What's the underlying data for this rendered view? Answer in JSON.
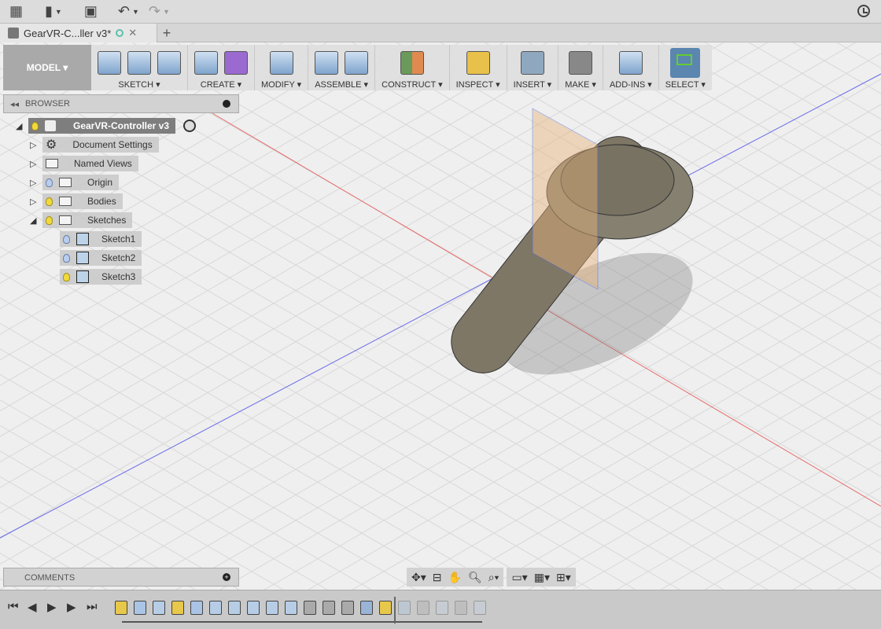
{
  "topbar": {
    "icons": [
      "apps-grid-icon",
      "file-icon",
      "save-icon",
      "undo-icon",
      "redo-icon",
      "clock-icon"
    ]
  },
  "tab": {
    "title": "GearVR-C...ller v3*",
    "close": "✕",
    "new_tab": "+"
  },
  "toolbar": {
    "workspace": "MODEL ▾",
    "groups": [
      {
        "label": "SKETCH ▾",
        "icons": [
          "create-sketch-icon",
          "spline-icon",
          "rectangle-icon"
        ]
      },
      {
        "label": "CREATE ▾",
        "icons": [
          "extrude-icon",
          "form-icon"
        ]
      },
      {
        "label": "MODIFY ▾",
        "icons": [
          "press-pull-icon"
        ]
      },
      {
        "label": "ASSEMBLE ▾",
        "icons": [
          "new-component-icon",
          "joint-icon"
        ]
      },
      {
        "label": "CONSTRUCT ▾",
        "icons": [
          "offset-plane-icon"
        ]
      },
      {
        "label": "INSPECT ▾",
        "icons": [
          "measure-icon"
        ]
      },
      {
        "label": "INSERT ▾",
        "icons": [
          "insert-image-icon"
        ]
      },
      {
        "label": "MAKE ▾",
        "icons": [
          "3d-print-icon"
        ]
      },
      {
        "label": "ADD-INS ▾",
        "icons": [
          "scripts-addins-icon"
        ]
      },
      {
        "label": "SELECT ▾",
        "icons": [
          "select-icon"
        ]
      }
    ]
  },
  "browser": {
    "title": "BROWSER",
    "root": "GearVR-Controller v3",
    "items": [
      {
        "label": "Document Settings",
        "icon": "gear-icon",
        "expanded": false
      },
      {
        "label": "Named Views",
        "icon": "folder-icon",
        "expanded": false
      },
      {
        "label": "Origin",
        "icon": "folder-icon",
        "visible": false,
        "expanded": false
      },
      {
        "label": "Bodies",
        "icon": "folder-icon",
        "visible": true,
        "expanded": false
      },
      {
        "label": "Sketches",
        "icon": "folder-icon",
        "visible": true,
        "expanded": true
      }
    ],
    "sketches": [
      {
        "label": "Sketch1",
        "visible": false
      },
      {
        "label": "Sketch2",
        "visible": false
      },
      {
        "label": "Sketch3",
        "visible": true
      }
    ]
  },
  "comments": {
    "title": "COMMENTS"
  },
  "navbar": [
    "orbit-icon",
    "look-at-icon",
    "pan-icon",
    "zoom-icon",
    "fit-icon",
    "display-settings-icon",
    "grid-icon",
    "viewports-icon"
  ],
  "timeline": {
    "controls": [
      "⏮",
      "◀",
      "▶",
      "▶",
      "⏭"
    ],
    "features": [
      "sketch",
      "extrude",
      "fillet",
      "sketch",
      "extrude",
      "fillet",
      "fillet",
      "fillet",
      "fillet",
      "fillet",
      "move",
      "move",
      "move",
      "shell",
      "sketch",
      "extrude",
      "move",
      "combine",
      "move",
      "combine"
    ],
    "marker_after": 15
  },
  "colors": {
    "accent": "#5a86b0",
    "plane": "#e8b47c",
    "body": "#7f7766"
  }
}
